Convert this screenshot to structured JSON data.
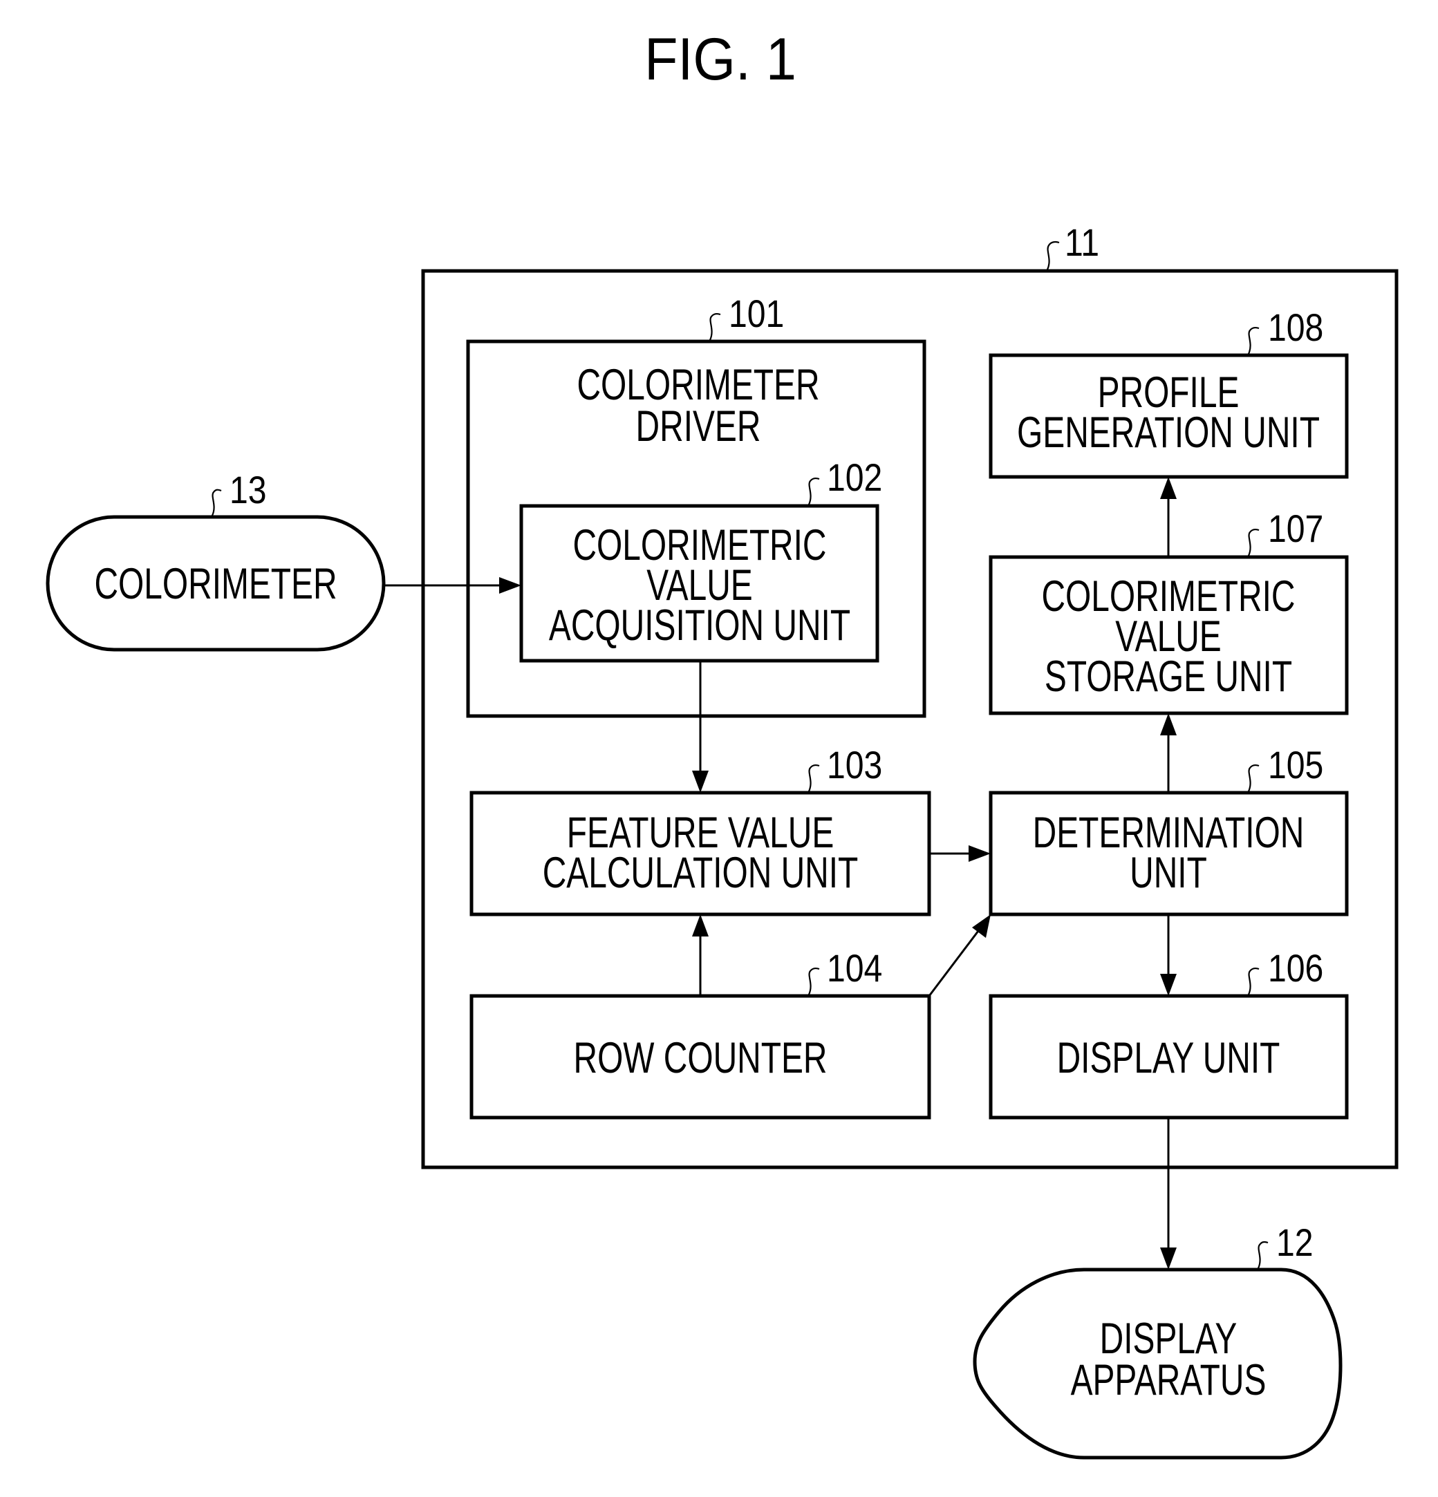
{
  "figure": {
    "title": "FIG. 1"
  },
  "components": {
    "system": {
      "ref": "11"
    },
    "colorimeter": {
      "ref": "13",
      "lines": [
        "COLORIMETER"
      ]
    },
    "display_apparatus": {
      "ref": "12",
      "lines": [
        "DISPLAY",
        "APPARATUS"
      ]
    },
    "colorimeter_driver": {
      "ref": "101",
      "lines": [
        "COLORIMETER",
        "DRIVER"
      ]
    },
    "colorimetric_value_acquisition_unit": {
      "ref": "102",
      "lines": [
        "COLORIMETRIC",
        "VALUE",
        "ACQUISITION UNIT"
      ]
    },
    "feature_value_calculation_unit": {
      "ref": "103",
      "lines": [
        "FEATURE VALUE",
        "CALCULATION UNIT"
      ]
    },
    "row_counter": {
      "ref": "104",
      "lines": [
        "ROW COUNTER"
      ]
    },
    "determination_unit": {
      "ref": "105",
      "lines": [
        "DETERMINATION",
        "UNIT"
      ]
    },
    "display_unit": {
      "ref": "106",
      "lines": [
        "DISPLAY UNIT"
      ]
    },
    "colorimetric_value_storage_unit": {
      "ref": "107",
      "lines": [
        "COLORIMETRIC",
        "VALUE",
        "STORAGE UNIT"
      ]
    },
    "profile_generation_unit": {
      "ref": "108",
      "lines": [
        "PROFILE",
        "GENERATION UNIT"
      ]
    }
  },
  "connections": [
    {
      "from": "colorimeter",
      "to": "colorimetric_value_acquisition_unit"
    },
    {
      "from": "colorimetric_value_acquisition_unit",
      "to": "feature_value_calculation_unit"
    },
    {
      "from": "row_counter",
      "to": "feature_value_calculation_unit"
    },
    {
      "from": "feature_value_calculation_unit",
      "to": "determination_unit"
    },
    {
      "from": "row_counter",
      "to": "determination_unit"
    },
    {
      "from": "determination_unit",
      "to": "colorimetric_value_storage_unit"
    },
    {
      "from": "colorimetric_value_storage_unit",
      "to": "profile_generation_unit"
    },
    {
      "from": "determination_unit",
      "to": "display_unit"
    },
    {
      "from": "display_unit",
      "to": "display_apparatus"
    }
  ]
}
